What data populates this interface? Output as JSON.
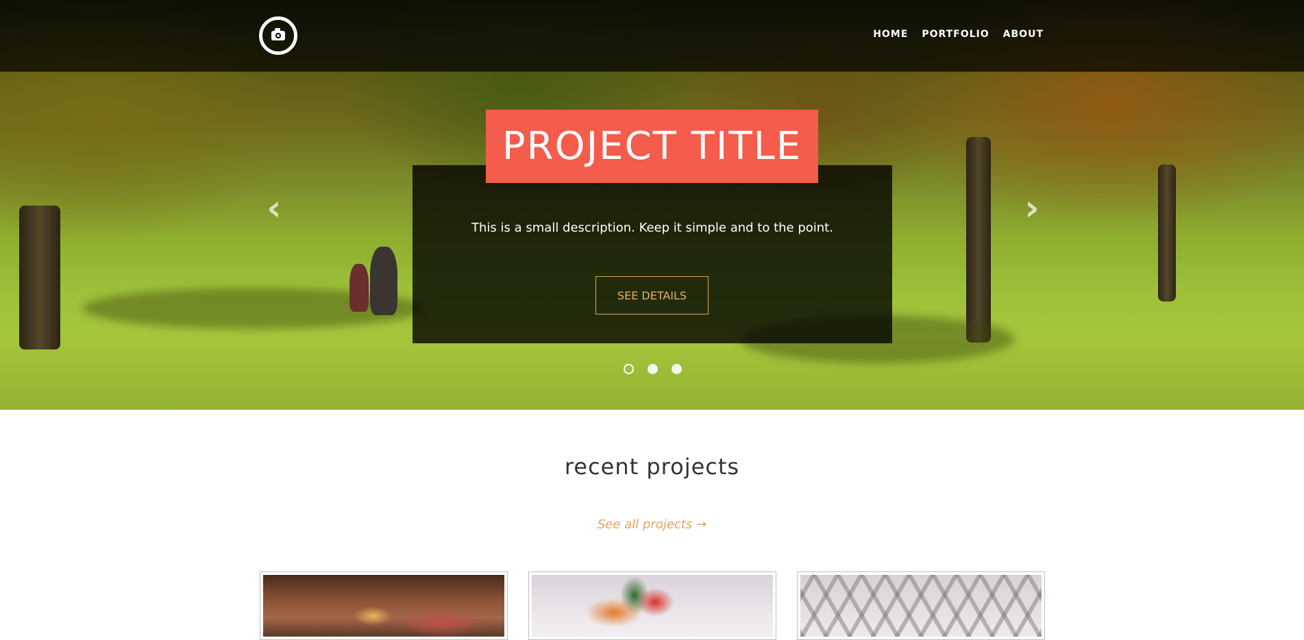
{
  "nav": {
    "logo_icon": "camera-icon",
    "links": [
      {
        "label": "HOME"
      },
      {
        "label": "PORTFOLIO"
      },
      {
        "label": "ABOUT"
      }
    ]
  },
  "hero": {
    "title": "PROJECT TITLE",
    "description": "This is a small description. Keep it simple and to the point.",
    "button_label": "SEE DETAILS",
    "prev_arrow": "‹",
    "next_arrow": "›",
    "indicator_count": 3,
    "active_indicator": 1
  },
  "projects": {
    "heading": "recent projects",
    "see_all": "See all projects →",
    "thumbnails": 3
  },
  "colors": {
    "accent": "#f45c4b",
    "button_border": "#d9a85a",
    "link": "#e8a15c"
  }
}
